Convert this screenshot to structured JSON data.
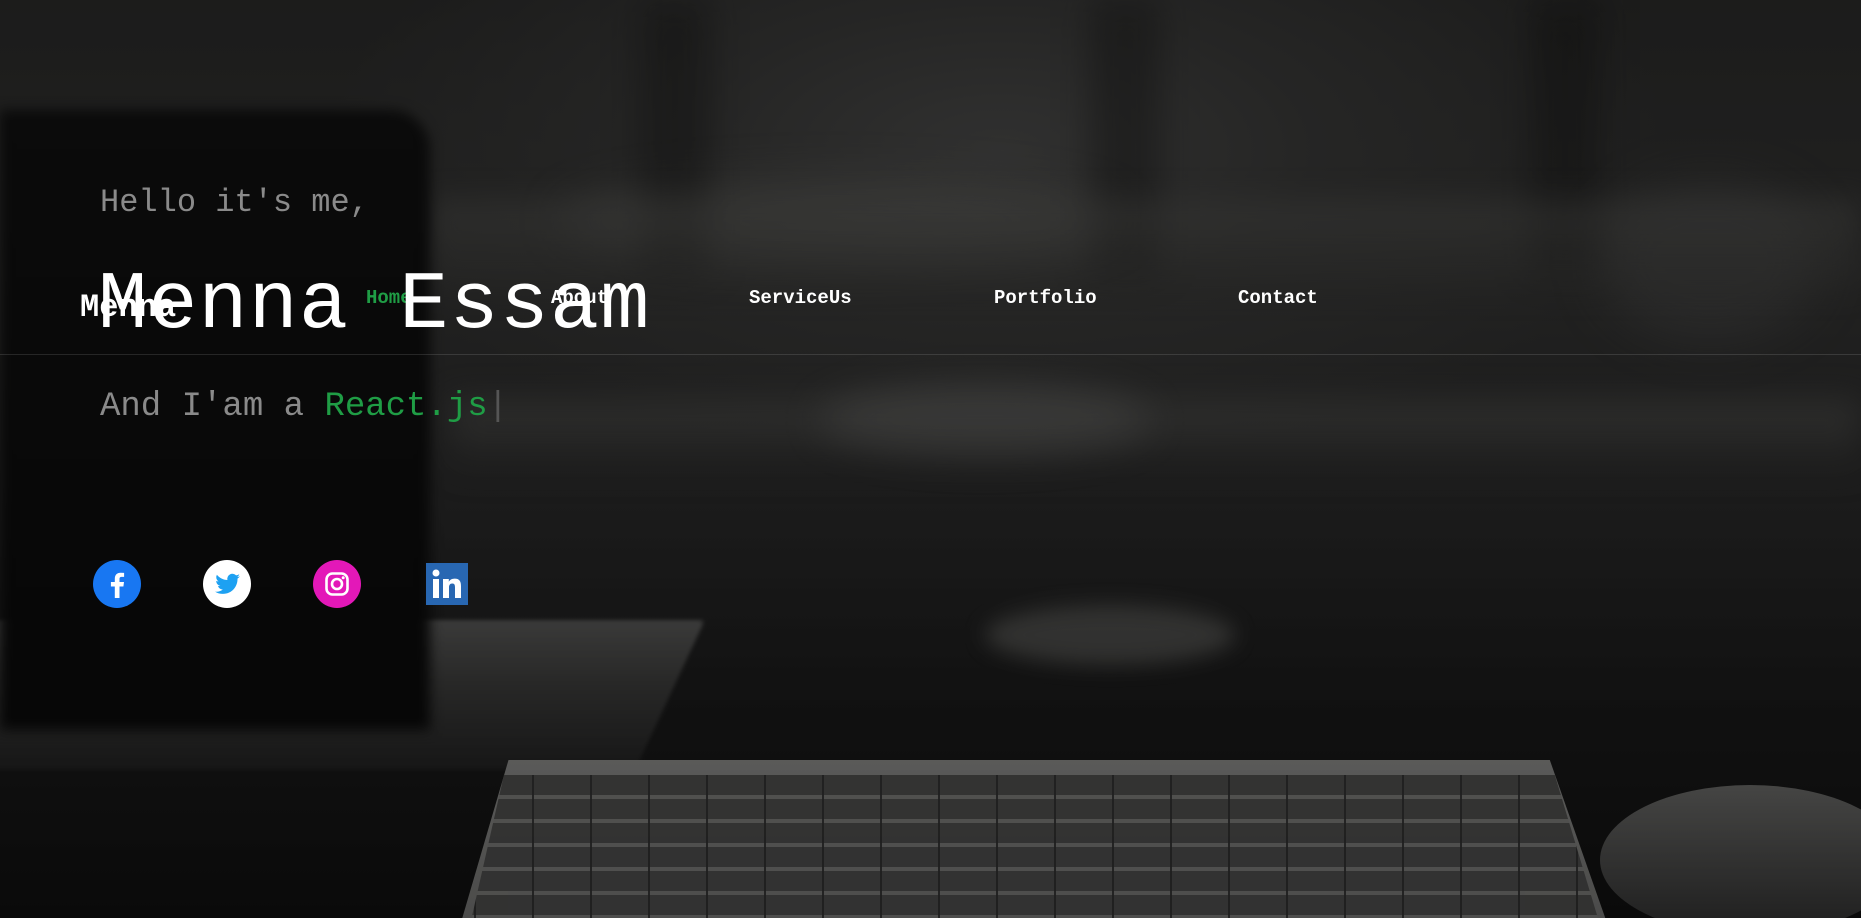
{
  "brand": {
    "logo": "Menna"
  },
  "nav": {
    "items": [
      {
        "label": "Home",
        "active": true
      },
      {
        "label": "About",
        "active": false
      },
      {
        "label": "ServiceUs",
        "active": false
      },
      {
        "label": "Portfolio",
        "active": false
      },
      {
        "label": "Contact",
        "active": false
      }
    ]
  },
  "hero": {
    "greeting": "Hello it's me,",
    "name": "Menna Essam",
    "role_prefix": "And I'am a ",
    "role_highlight": "React.js",
    "cursor": "|"
  },
  "social": [
    {
      "icon": "facebook-icon",
      "color": "#1877F2"
    },
    {
      "icon": "twitter-icon",
      "color": "#1DA1F2"
    },
    {
      "icon": "instagram-icon",
      "color": "#E1306C"
    },
    {
      "icon": "linkedin-icon",
      "color": "#2867B2"
    }
  ],
  "colors": {
    "accent": "#1f9d45",
    "text": "#ffffff",
    "muted": "#8a8a8a"
  }
}
